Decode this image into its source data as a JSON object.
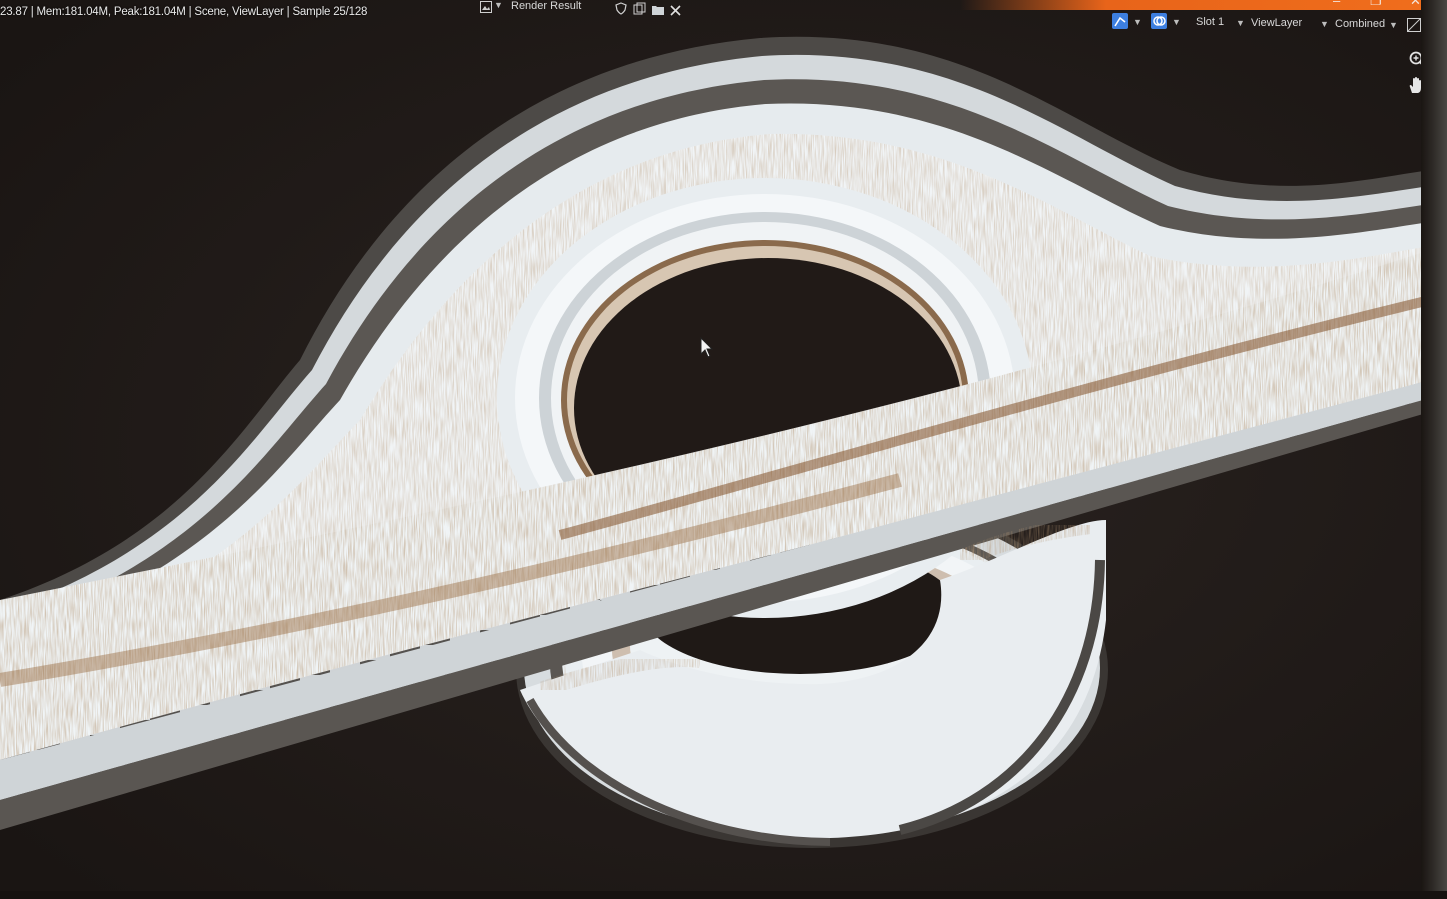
{
  "status_bar": {
    "stats": "23.87 | Mem:181.04M, Peak:181.04M | Scene, ViewLayer | Sample 25/128"
  },
  "image_editor": {
    "image_name": "Render Result",
    "slot": "Slot 1",
    "view_layer": "ViewLayer",
    "pass": "Combined"
  },
  "window_controls": {
    "minimize": "–",
    "maximize": "❐",
    "close": "✕"
  },
  "icons": {
    "image_browse": "image-icon",
    "fake_user": "shield-icon",
    "duplicate": "duplicate-icon",
    "open": "folder-icon",
    "unlink": "close-icon",
    "gizmo": "gizmo-icon",
    "overlay": "overlay-icon",
    "display_channels": "display-channels-icon",
    "zoom": "zoom-icon",
    "pan": "hand-icon",
    "cursor": "mouse-cursor-icon"
  },
  "colors": {
    "background": "#201a17",
    "accent_orange": "#f06e1c",
    "disk_light": "#e8eef2",
    "disk_brown": "#7a5433",
    "checker_dark": "#4c4b49",
    "checker_light": "#c9ccce",
    "ui_blue": "#3d7fe0"
  }
}
